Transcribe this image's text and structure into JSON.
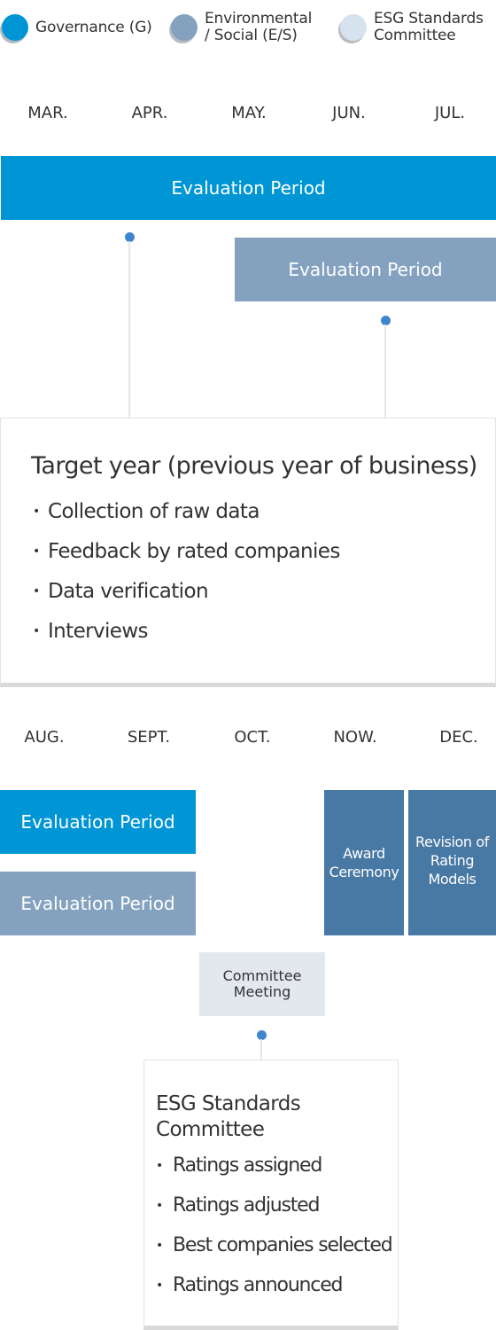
{
  "legend": [
    {
      "label_line1": "Governance (G)",
      "label_line2": "",
      "color": "#0096d6",
      "icon": "circle-icon"
    },
    {
      "label_line1": "Environmental",
      "label_line2": "/ Social (E/S)",
      "color": "#84a2bf",
      "icon": "circle-icon"
    },
    {
      "label_line1": "ESG Standards",
      "label_line2": "Committee",
      "color": "#d6e2ed",
      "icon": "circle-icon"
    }
  ],
  "first_half": {
    "months": [
      "MAR.",
      "APR.",
      "MAY.",
      "JUN.",
      "JUL."
    ],
    "governance_bar": {
      "label": "Evaluation Period",
      "start_month": "MAR.",
      "end_month": "JUL."
    },
    "es_bar": {
      "label": "Evaluation Period",
      "start_month": "MAY.",
      "end_month": "JUL."
    },
    "details": {
      "title": "Target year (previous year of business)",
      "bullet": "•",
      "items": [
        "Collection of raw data",
        "Feedback by rated companies",
        "Data verification",
        "Interviews"
      ]
    }
  },
  "second_half": {
    "months": [
      "AUG.",
      "SEPT.",
      "OCT.",
      "NOW.",
      "DEC."
    ],
    "governance_bar": {
      "label": "Evaluation Period",
      "start_month": "AUG.",
      "end_month": "SEPT."
    },
    "es_bar": {
      "label": "Evaluation Period",
      "start_month": "AUG.",
      "end_month": "SEPT."
    },
    "award_ceremony": {
      "line1": "Award",
      "line2": "Ceremony",
      "month": "NOW."
    },
    "revision": {
      "line1": "Revision of",
      "line2": "Rating",
      "line3": "Models",
      "month": "DEC."
    },
    "committee_meeting": {
      "line1": "Committee",
      "line2": "Meeting",
      "month": "OCT."
    },
    "details": {
      "title_line1": "ESG Standards",
      "title_line2": "Committee",
      "bullet": "•",
      "items": [
        "Ratings assigned",
        "Ratings adjusted",
        "Best companies selected",
        "Ratings announced"
      ]
    }
  },
  "colors": {
    "governance": "#0096d6",
    "environmental_social": "#84a2bf",
    "committee": "#d6e2ed",
    "event_dark": "#4878a4",
    "connector_dot": "#3d86cf"
  }
}
